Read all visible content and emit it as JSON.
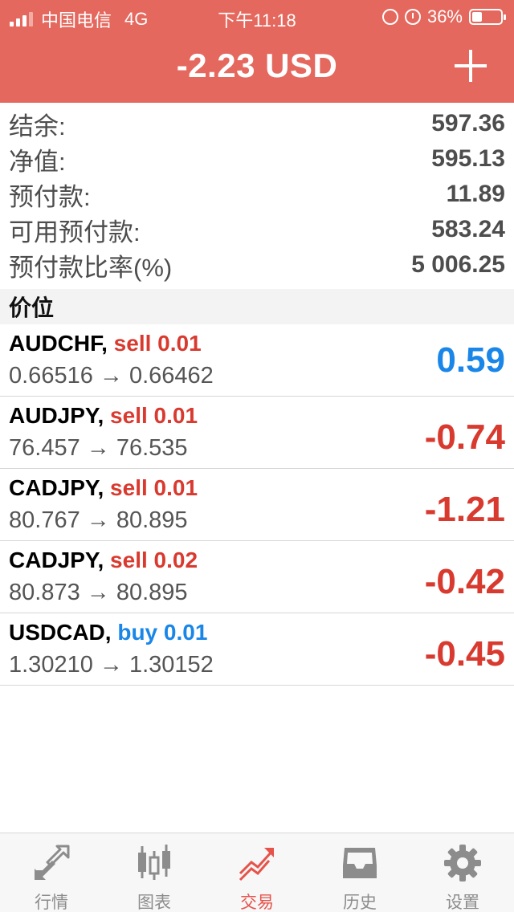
{
  "status_bar": {
    "carrier": "中国电信",
    "network": "4G",
    "time": "下午11:18",
    "battery": "36%"
  },
  "header": {
    "title": "-2.23 USD",
    "add_icon": "plus-icon",
    "color": "#e5685e"
  },
  "summary": [
    {
      "label": "结余:",
      "value": "597.36"
    },
    {
      "label": "净值:",
      "value": "595.13"
    },
    {
      "label": "预付款:",
      "value": "11.89"
    },
    {
      "label": "可用预付款:",
      "value": "583.24"
    },
    {
      "label": "预付款比率(%)",
      "value": "5 006.25"
    }
  ],
  "section_title": "价位",
  "positions": [
    {
      "symbol": "AUDCHF,",
      "side": "sell 0.01",
      "side_type": "sell",
      "prices": "0.66516 → 0.66462",
      "profit": "0.59",
      "profit_sign": "positive"
    },
    {
      "symbol": "AUDJPY,",
      "side": "sell 0.01",
      "side_type": "sell",
      "prices": "76.457 → 76.535",
      "profit": "-0.74",
      "profit_sign": "negative"
    },
    {
      "symbol": "CADJPY,",
      "side": "sell 0.01",
      "side_type": "sell",
      "prices": "80.767 → 80.895",
      "profit": "-1.21",
      "profit_sign": "negative"
    },
    {
      "symbol": "CADJPY,",
      "side": "sell 0.02",
      "side_type": "sell",
      "prices": "80.873 → 80.895",
      "profit": "-0.42",
      "profit_sign": "negative"
    },
    {
      "symbol": "USDCAD,",
      "side": "buy 0.01",
      "side_type": "buy",
      "prices": "1.30210 → 1.30152",
      "profit": "-0.45",
      "profit_sign": "negative"
    }
  ],
  "tabs": [
    {
      "label": "行情",
      "icon": "quotes-arrows-icon",
      "active": false
    },
    {
      "label": "图表",
      "icon": "candlestick-chart-icon",
      "active": false
    },
    {
      "label": "交易",
      "icon": "trade-trend-icon",
      "active": true
    },
    {
      "label": "历史",
      "icon": "history-inbox-icon",
      "active": false
    },
    {
      "label": "设置",
      "icon": "gear-icon",
      "active": false
    }
  ],
  "colors": {
    "accent": "#e5685e",
    "sell": "#d93a2f",
    "buy": "#1a86e8",
    "tab_active": "#e5534b",
    "tab_inactive": "#8c8c8c"
  }
}
